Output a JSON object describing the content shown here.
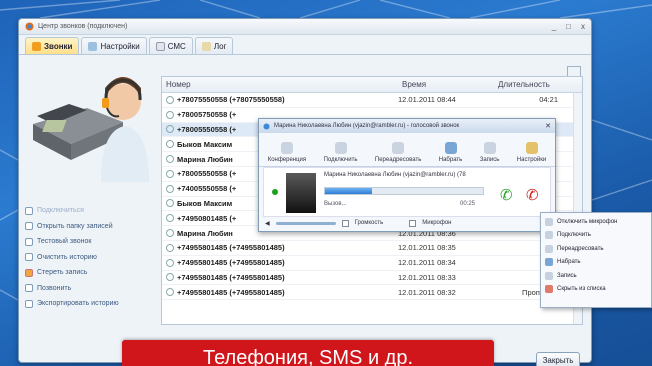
{
  "window": {
    "title": "Центр звонков (подключен)",
    "controls": [
      "_",
      "□",
      "x"
    ]
  },
  "tabs": [
    {
      "label": "Звонки",
      "active": true
    },
    {
      "label": "Настройки",
      "active": false
    },
    {
      "label": "СМС",
      "active": false
    },
    {
      "label": "Лог",
      "active": false
    }
  ],
  "actions": [
    {
      "label": "Подключиться",
      "disabled": true
    },
    {
      "label": "Открыть папку записей",
      "disabled": false
    },
    {
      "label": "Тестовый звонок",
      "disabled": false
    },
    {
      "label": "Очистить историю",
      "disabled": false
    },
    {
      "label": "Стереть запись",
      "disabled": false
    },
    {
      "label": "Позвонить",
      "disabled": false
    },
    {
      "label": "Экспортировать историю",
      "disabled": false
    }
  ],
  "table": {
    "headers": {
      "number": "Номер",
      "time": "Время",
      "duration": "Длительность"
    },
    "rows": [
      {
        "number": "+78075550558 (+78075550558)",
        "time": "12.01.2011 08:44",
        "duration": "04:21"
      },
      {
        "number": "+78005750558 (+",
        "time": "",
        "duration": ""
      },
      {
        "number": "+78005550558 (+",
        "time": "",
        "duration": ""
      },
      {
        "number": "Быков Максим",
        "time": "",
        "duration": ""
      },
      {
        "number": "Марина Любин",
        "time": "",
        "duration": ""
      },
      {
        "number": "+78005550558 (+",
        "time": "",
        "duration": ""
      },
      {
        "number": "+74005550558 (+",
        "time": "",
        "duration": ""
      },
      {
        "number": "Быков Максим",
        "time": "",
        "duration": ""
      },
      {
        "number": "+74950801485 (+",
        "time": "",
        "duration": ""
      },
      {
        "number": "Марина Любин",
        "time": "12.01.2011 08:36",
        "duration": ""
      },
      {
        "number": "+74955801485 (+74955801485)",
        "time": "12.01.2011 08:35",
        "duration": ""
      },
      {
        "number": "+74955801485 (+74955801485)",
        "time": "12.01.2011 08:34",
        "duration": ""
      },
      {
        "number": "+74955801485 (+74955801485)",
        "time": "12.01.2011 08:33",
        "duration": ""
      },
      {
        "number": "+74955801485 (+74955801485)",
        "time": "12.01.2011 08:32",
        "duration": "Пропущен"
      }
    ]
  },
  "close_button": "Закрыть",
  "popup": {
    "title": "Марина Николаевна Любин (vjazin@rambler.ru) - голосовой звонок",
    "toolbar": [
      "Конференция",
      "Подключить",
      "Переадресовать",
      "Набрать",
      "Запись",
      "Настройки"
    ],
    "caller": "Марина Николаевна Любин (vjazin@rambler.ru) (78",
    "status": "Вызов...",
    "timer": "00:25",
    "progress": 0.3,
    "footer": {
      "mute_label": "Громкость",
      "mic_label": "Микрофон"
    }
  },
  "context_menu": [
    "Отключить микрофон",
    "Подключить",
    "Переадресовать",
    "Набрать",
    "Запись",
    "Скрыть из списка"
  ],
  "banner": "Телефония, SMS и др.",
  "colors": {
    "banner": "#d1161b",
    "accept": "#2aa52a",
    "hangup": "#d62020",
    "background": "#2b7bd0"
  }
}
